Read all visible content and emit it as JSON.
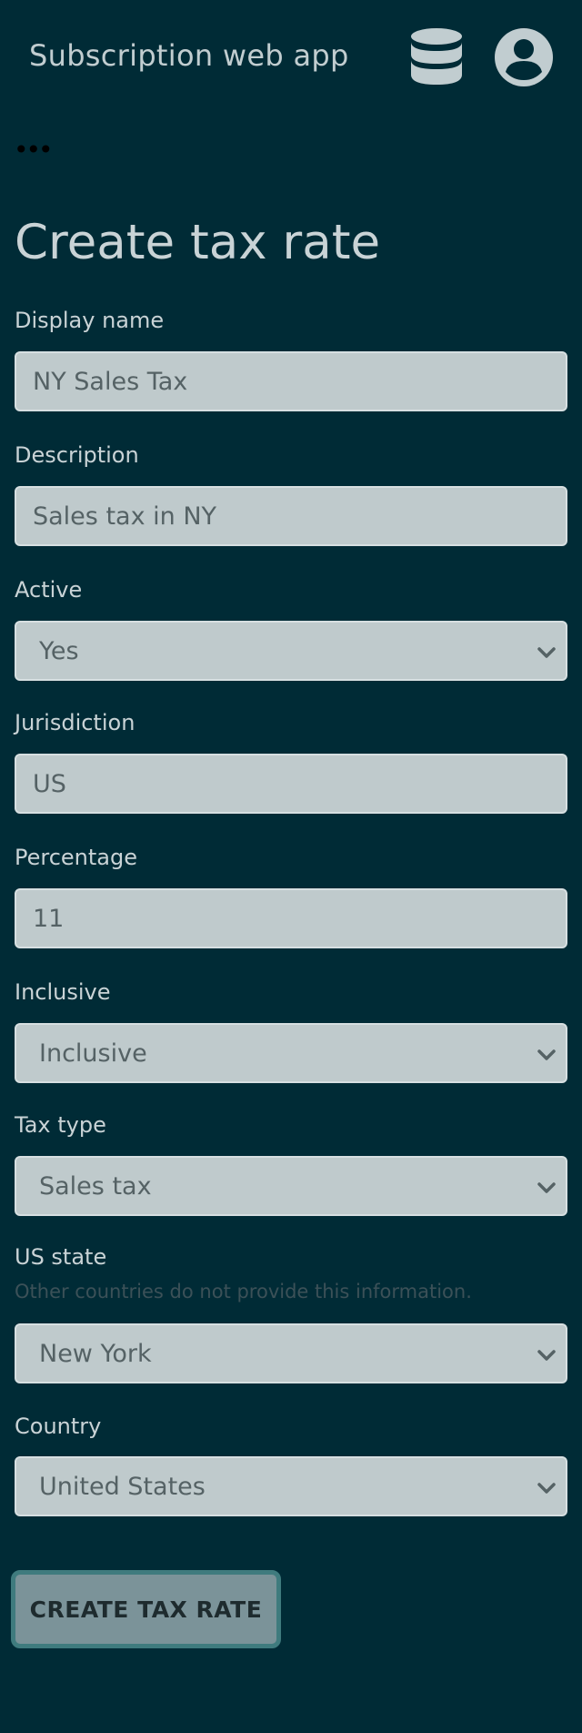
{
  "header": {
    "app_title": "Subscription web app",
    "icons": [
      "database-icon",
      "user-account-icon"
    ]
  },
  "more_icon_glyph": "•••",
  "page_title": "Create tax rate",
  "fields": {
    "display_name": {
      "label": "Display name",
      "value": "NY Sales Tax"
    },
    "description": {
      "label": "Description",
      "value": "Sales tax in NY"
    },
    "active": {
      "label": "Active",
      "value": "Yes"
    },
    "jurisdiction": {
      "label": "Jurisdiction",
      "value": "US"
    },
    "percentage": {
      "label": "Percentage",
      "value": "11"
    },
    "inclusive": {
      "label": "Inclusive",
      "value": "Inclusive"
    },
    "tax_type": {
      "label": "Tax type",
      "value": "Sales tax"
    },
    "us_state": {
      "label": "US state",
      "hint": "Other countries do not provide this information.",
      "value": "New York"
    },
    "country": {
      "label": "Country",
      "value": "United States"
    }
  },
  "submit_label": "CREATE TAX RATE",
  "colors": {
    "background": "#002b36",
    "field_background": "#bfcacc",
    "button_background": "#7b9399",
    "button_border": "#3f7b7e"
  }
}
